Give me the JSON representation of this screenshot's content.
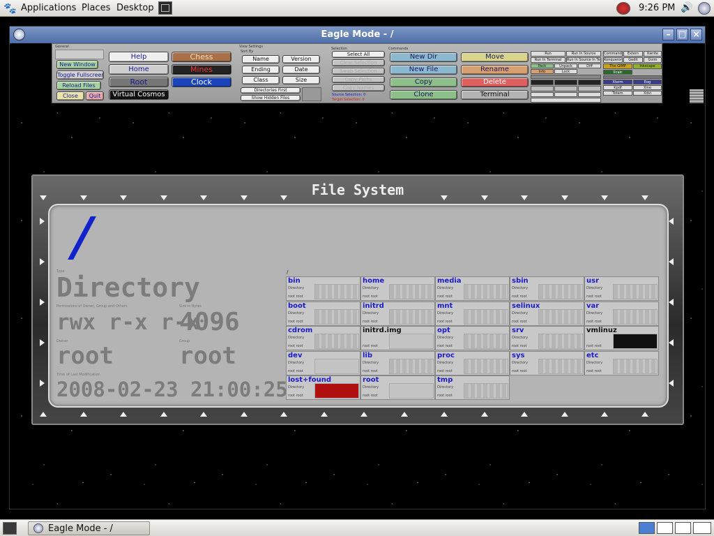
{
  "top_panel": {
    "menus": [
      "Applications",
      "Places",
      "Desktop"
    ],
    "clock": "9:26 PM"
  },
  "window": {
    "title": "Eagle Mode - /"
  },
  "control_panel": {
    "section_labels": {
      "general": "General",
      "help": "Help",
      "view_settings": "View Settings",
      "sort_by": "Sort By",
      "selection": "Selection",
      "commands": "Commands"
    },
    "general_buttons": [
      "New Window",
      "Toggle Fullscreen",
      "Reload Files",
      "Close",
      "Quit"
    ],
    "bookmark_buttons": [
      "Help",
      "Chess",
      "Home",
      "Mines",
      "Root",
      "Clock",
      "Virtual Cosmos"
    ],
    "sort_buttons": [
      "Name",
      "Version",
      "Ending",
      "Date",
      "Class",
      "Size"
    ],
    "view_toggles": [
      "Directories First",
      "Show Hidden Files"
    ],
    "selection_buttons": [
      "Select All",
      "Clear Selection",
      "Swap Selection",
      "Copy Paths",
      "Copy Names"
    ],
    "selection_counts": [
      "Source Selection: 0",
      "Target Selection: 0"
    ],
    "command_buttons": [
      "New Dir",
      "Move",
      "New File",
      "Rename",
      "Copy",
      "Delete",
      "Clone",
      "Terminal"
    ],
    "extra_commands": [
      "Run",
      "Run In Source",
      "Run In Terminal",
      "Run In Source In Terminal",
      "Pack",
      "Unpack",
      "Diff",
      "Info",
      "Lock",
      "Command",
      "Extern",
      "Kwrite",
      "Konqueror",
      "Gedit",
      "Gvim",
      "The GIMP",
      "Inkscape",
      "Xcalc",
      "Xterm",
      "Eog",
      "Kpdf",
      "Xine",
      "Totem",
      "Xdvi"
    ]
  },
  "file_system": {
    "title": "File System",
    "name": "/",
    "labels": {
      "type": "Type",
      "permissions": "Permissions of Owner, Group and Others",
      "size": "Size in Bytes",
      "owner": "Owner",
      "group": "Group",
      "mtime": "Time of Last Modification"
    },
    "type": "Directory",
    "permissions": "rwx r-x r-x",
    "size": "4096",
    "owner": "root",
    "group": "root",
    "mtime": "2008-02-23 21:00:25",
    "path": "/",
    "entries": [
      {
        "name": "bin",
        "kind": "dir"
      },
      {
        "name": "home",
        "kind": "dir"
      },
      {
        "name": "media",
        "kind": "dir"
      },
      {
        "name": "sbin",
        "kind": "dir"
      },
      {
        "name": "usr",
        "kind": "dir"
      },
      {
        "name": "boot",
        "kind": "dir"
      },
      {
        "name": "initrd",
        "kind": "dir"
      },
      {
        "name": "mnt",
        "kind": "dir"
      },
      {
        "name": "selinux",
        "kind": "dir"
      },
      {
        "name": "var",
        "kind": "dir"
      },
      {
        "name": "cdrom",
        "kind": "dir"
      },
      {
        "name": "initrd.img",
        "kind": "file"
      },
      {
        "name": "opt",
        "kind": "dir"
      },
      {
        "name": "srv",
        "kind": "dir"
      },
      {
        "name": "vmlinuz",
        "kind": "file"
      },
      {
        "name": "dev",
        "kind": "dir"
      },
      {
        "name": "lib",
        "kind": "dir"
      },
      {
        "name": "proc",
        "kind": "dir"
      },
      {
        "name": "sys",
        "kind": "dir"
      },
      {
        "name": "etc",
        "kind": "dir"
      },
      {
        "name": "lost+found",
        "kind": "dir"
      },
      {
        "name": "root",
        "kind": "dir"
      },
      {
        "name": "tmp",
        "kind": "dir"
      }
    ],
    "entry_type_dir": "Directory",
    "entry_owner_line": "root root"
  },
  "taskbar": {
    "task_label": "Eagle Mode - /"
  }
}
